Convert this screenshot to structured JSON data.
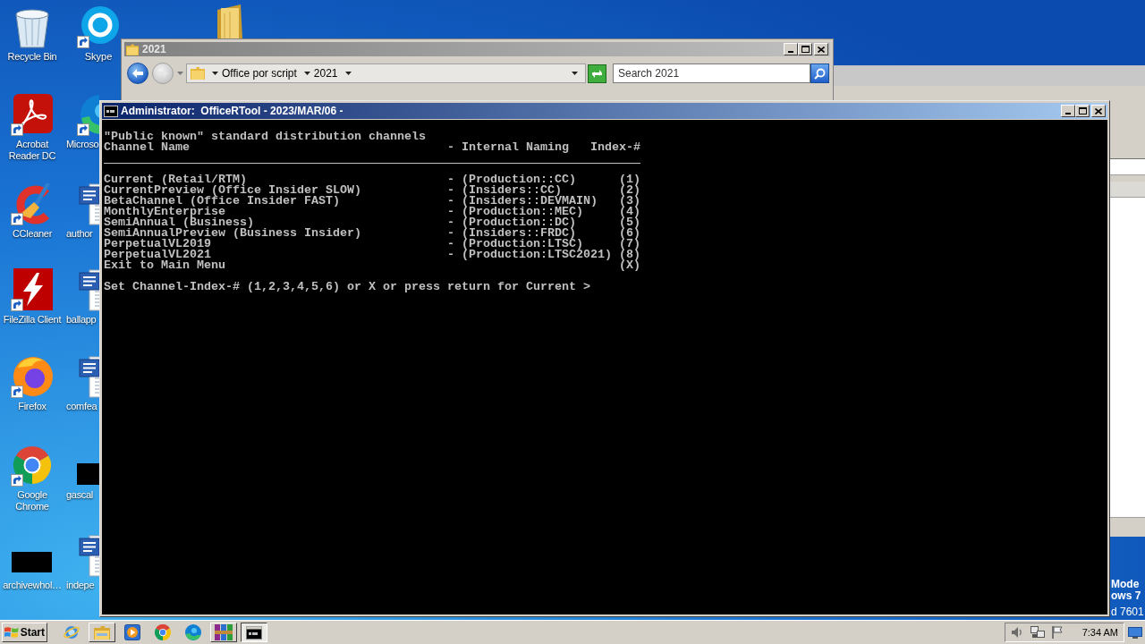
{
  "desktop": {
    "columns": [
      [
        {
          "label": "Recycle Bin",
          "kind": "recycle-bin"
        },
        {
          "label": "Acrobat Reader DC",
          "kind": "acrobat"
        },
        {
          "label": "CCleaner",
          "kind": "ccleaner"
        },
        {
          "label": "FileZilla Client",
          "kind": "filezilla"
        },
        {
          "label": "Firefox",
          "kind": "firefox"
        },
        {
          "label": "Google Chrome",
          "kind": "chrome"
        },
        {
          "label": "archivewhol…",
          "kind": "thumbnail"
        }
      ],
      [
        {
          "label": "Skype",
          "kind": "skype"
        },
        {
          "label": "Microso",
          "kind": "edge"
        },
        {
          "label": "author",
          "kind": "word-doc"
        },
        {
          "label": "ballapp",
          "kind": "word-doc"
        },
        {
          "label": "comfea",
          "kind": "word-doc"
        },
        {
          "label": "gascal",
          "kind": "thumbnail"
        },
        {
          "label": "indepe",
          "kind": "word-doc"
        }
      ]
    ],
    "test_mode_text": [
      "Mode",
      "ows 7",
      "d 7601"
    ]
  },
  "explorer_window": {
    "title": "2021",
    "address": [
      "Office por script",
      "2021"
    ],
    "search": {
      "placeholder": "Search 2021"
    }
  },
  "console_window": {
    "title": "Administrator:  OfficeRTool - 2023/MAR/06 -",
    "heading": "\"Public known\" standard distribution channels",
    "columns": [
      "Channel Name",
      "- Internal Naming",
      "Index-#"
    ],
    "rows": [
      {
        "name": "Current (Retail/RTM)",
        "internal": "- (Production::CC)",
        "index": "(1)"
      },
      {
        "name": "CurrentPreview (Office Insider SLOW)",
        "internal": "- (Insiders::CC)",
        "index": "(2)"
      },
      {
        "name": "BetaChannel (Office Insider FAST)",
        "internal": "- (Insiders::DEVMAIN)",
        "index": "(3)"
      },
      {
        "name": "MonthlyEnterprise",
        "internal": "- (Production::MEC)",
        "index": "(4)"
      },
      {
        "name": "SemiAnnual (Business)",
        "internal": "- (Production::DC)",
        "index": "(5)"
      },
      {
        "name": "SemiAnnualPreview (Business Insider)",
        "internal": "- (Insiders::FRDC)",
        "index": "(6)"
      },
      {
        "name": "PerpetualVL2019",
        "internal": "- (Production:LTSC)",
        "index": "(7)"
      },
      {
        "name": "PerpetualVL2021",
        "internal": "- (Production:LTSC2021)",
        "index": "(8)"
      },
      {
        "name": "Exit to Main Menu",
        "index": "(X)"
      }
    ],
    "prompt": "Set Channel-Index-# (1,2,3,4,5,6) or X or press return for Current >"
  },
  "taskbar": {
    "start": "Start",
    "apps": [
      {
        "kind": "ie",
        "running": false,
        "selected": false
      },
      {
        "kind": "folder",
        "running": true,
        "selected": false
      },
      {
        "kind": "media",
        "running": false,
        "selected": false
      },
      {
        "kind": "chrome",
        "running": false,
        "selected": false
      },
      {
        "kind": "edge",
        "running": false,
        "selected": false
      },
      {
        "kind": "archive",
        "running": true,
        "selected": false
      },
      {
        "kind": "console",
        "running": true,
        "selected": true
      }
    ],
    "clock": "7:34 AM"
  }
}
